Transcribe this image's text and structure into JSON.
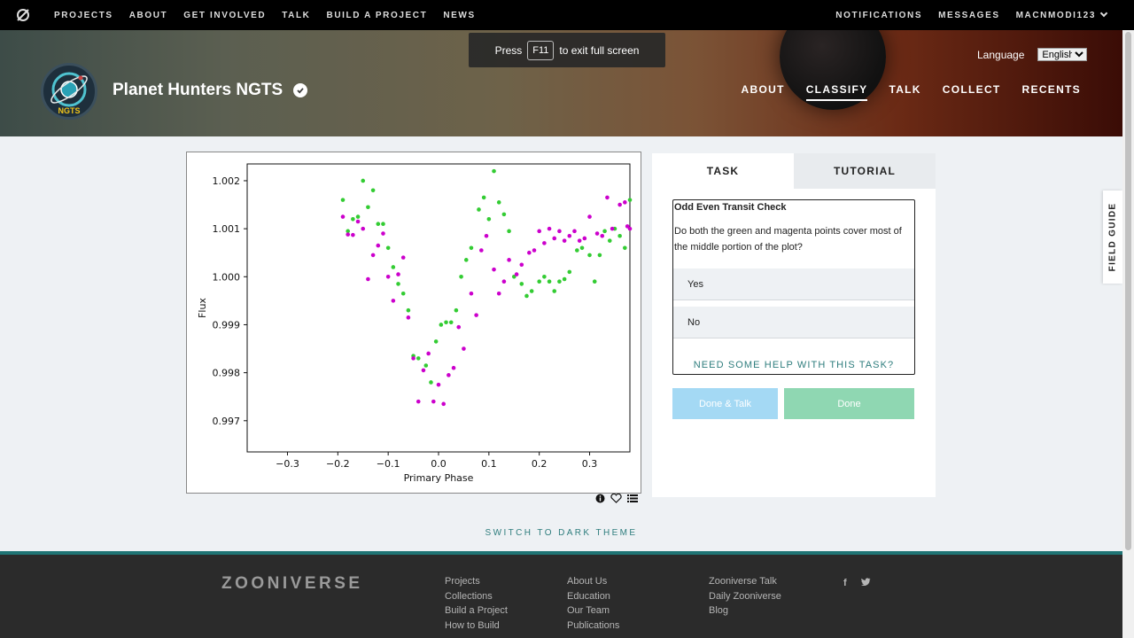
{
  "topnav": {
    "links": [
      "PROJECTS",
      "ABOUT",
      "GET INVOLVED",
      "TALK",
      "BUILD A PROJECT",
      "NEWS"
    ],
    "notifications": "NOTIFICATIONS",
    "messages": "MESSAGES",
    "username": "MACNMODI123"
  },
  "fullscreen_toast": {
    "press": "Press",
    "key": "F11",
    "rest": "to exit full screen"
  },
  "hero": {
    "project_title": "Planet Hunters NGTS",
    "badge_text": "NGTS",
    "language_label": "Language",
    "language_value": "English",
    "nav": [
      "ABOUT",
      "CLASSIFY",
      "TALK",
      "COLLECT",
      "RECENTS"
    ],
    "active_nav": "CLASSIFY"
  },
  "chart_data": {
    "type": "scatter",
    "xlabel": "Primary Phase",
    "ylabel": "Flux",
    "xlim": [
      -0.38,
      0.38
    ],
    "ylim": [
      0.99635,
      1.00235
    ],
    "xticks": [
      "−0.3",
      "−0.2",
      "−0.1",
      "0.0",
      "0.1",
      "0.2",
      "0.3"
    ],
    "yticks": [
      "1.002",
      "1.001",
      "1.000",
      "0.999",
      "0.998",
      "0.997"
    ],
    "series": [
      {
        "color": "#33cc33",
        "points": [
          [
            -0.19,
            1.0016
          ],
          [
            -0.18,
            1.00095
          ],
          [
            -0.17,
            1.0012
          ],
          [
            -0.16,
            1.00125
          ],
          [
            -0.15,
            1.002
          ],
          [
            -0.14,
            1.00145
          ],
          [
            -0.13,
            1.0018
          ],
          [
            -0.12,
            1.0011
          ],
          [
            -0.11,
            1.0011
          ],
          [
            -0.1,
            1.0006
          ],
          [
            -0.09,
            1.0002
          ],
          [
            -0.08,
            0.99985
          ],
          [
            -0.07,
            0.99965
          ],
          [
            -0.06,
            0.9993
          ],
          [
            -0.05,
            0.99835
          ],
          [
            -0.04,
            0.9983
          ],
          [
            -0.025,
            0.99815
          ],
          [
            -0.015,
            0.9978
          ],
          [
            -0.005,
            0.99865
          ],
          [
            0.005,
            0.999
          ],
          [
            0.015,
            0.99905
          ],
          [
            0.025,
            0.99905
          ],
          [
            0.035,
            0.9993
          ],
          [
            0.045,
            1.0
          ],
          [
            0.055,
            1.00035
          ],
          [
            0.065,
            1.0006
          ],
          [
            0.08,
            1.0014
          ],
          [
            0.09,
            1.00165
          ],
          [
            0.1,
            1.0012
          ],
          [
            0.11,
            1.0022
          ],
          [
            0.12,
            1.00155
          ],
          [
            0.13,
            1.0013
          ],
          [
            0.14,
            1.00095
          ],
          [
            0.15,
            1.0
          ],
          [
            0.165,
            0.99985
          ],
          [
            0.175,
            0.9996
          ],
          [
            0.185,
            0.9997
          ],
          [
            0.2,
            0.9999
          ],
          [
            0.21,
            1.0
          ],
          [
            0.22,
            0.9999
          ],
          [
            0.23,
            0.9997
          ],
          [
            0.24,
            0.9999
          ],
          [
            0.25,
            0.99995
          ],
          [
            0.26,
            1.0001
          ],
          [
            0.275,
            1.00055
          ],
          [
            0.285,
            1.0006
          ],
          [
            0.3,
            1.00045
          ],
          [
            0.31,
            0.9999
          ],
          [
            0.32,
            1.00045
          ],
          [
            0.33,
            1.00095
          ],
          [
            0.34,
            1.00075
          ],
          [
            0.35,
            1.001
          ],
          [
            0.36,
            1.00085
          ],
          [
            0.37,
            1.0006
          ],
          [
            0.38,
            1.0016
          ]
        ]
      },
      {
        "color": "#cc00cc",
        "points": [
          [
            -0.19,
            1.00125
          ],
          [
            -0.18,
            1.00088
          ],
          [
            -0.17,
            1.00087
          ],
          [
            -0.16,
            1.00115
          ],
          [
            -0.15,
            1.001
          ],
          [
            -0.14,
            0.99995
          ],
          [
            -0.13,
            1.00045
          ],
          [
            -0.12,
            1.00065
          ],
          [
            -0.11,
            1.0009
          ],
          [
            -0.1,
            1.0
          ],
          [
            -0.09,
            0.9995
          ],
          [
            -0.08,
            1.00005
          ],
          [
            -0.07,
            1.0004
          ],
          [
            -0.06,
            0.99915
          ],
          [
            -0.05,
            0.9983
          ],
          [
            -0.04,
            0.9974
          ],
          [
            -0.03,
            0.99805
          ],
          [
            -0.02,
            0.9984
          ],
          [
            -0.01,
            0.9974
          ],
          [
            0.0,
            0.99775
          ],
          [
            0.01,
            0.99735
          ],
          [
            0.02,
            0.99795
          ],
          [
            0.03,
            0.9981
          ],
          [
            0.04,
            0.99895
          ],
          [
            0.05,
            0.9985
          ],
          [
            0.065,
            0.99965
          ],
          [
            0.075,
            0.9992
          ],
          [
            0.085,
            1.00055
          ],
          [
            0.095,
            1.00085
          ],
          [
            0.11,
            1.00015
          ],
          [
            0.12,
            0.99965
          ],
          [
            0.13,
            0.9999
          ],
          [
            0.14,
            1.00035
          ],
          [
            0.155,
            1.00005
          ],
          [
            0.165,
            1.00025
          ],
          [
            0.18,
            1.0005
          ],
          [
            0.19,
            1.00055
          ],
          [
            0.2,
            1.00095
          ],
          [
            0.21,
            1.0007
          ],
          [
            0.22,
            1.001
          ],
          [
            0.23,
            1.0008
          ],
          [
            0.24,
            1.00095
          ],
          [
            0.25,
            1.00075
          ],
          [
            0.26,
            1.00085
          ],
          [
            0.27,
            1.00095
          ],
          [
            0.28,
            1.00075
          ],
          [
            0.29,
            1.0008
          ],
          [
            0.3,
            1.00125
          ],
          [
            0.315,
            1.0009
          ],
          [
            0.325,
            1.00085
          ],
          [
            0.335,
            1.00165
          ],
          [
            0.345,
            1.001
          ],
          [
            0.36,
            1.0015
          ],
          [
            0.37,
            1.00155
          ],
          [
            0.375,
            1.00105
          ],
          [
            0.38,
            1.001
          ]
        ]
      }
    ]
  },
  "subject_tools": {
    "info_icon": "info-icon",
    "favorite_icon": "heart-icon",
    "collect_icon": "list-icon"
  },
  "tabs": [
    "TASK",
    "TUTORIAL"
  ],
  "task": {
    "title": "Odd Even Transit Check",
    "question": "Do both the green and magenta points cover most of the middle portion of the plot?",
    "answers": [
      "Yes",
      "No"
    ],
    "help": "NEED SOME HELP WITH THIS TASK?",
    "done_talk": "Done & Talk",
    "done": "Done"
  },
  "field_guide": "FIELD GUIDE",
  "theme_switch": "SWITCH TO DARK THEME",
  "footer": {
    "brand": "ZOONIVERSE",
    "col1": [
      "Projects",
      "Collections",
      "Build a Project",
      "How to Build"
    ],
    "col2": [
      "About Us",
      "Education",
      "Our Team",
      "Publications"
    ],
    "col3": [
      "Zooniverse Talk",
      "Daily Zooniverse",
      "Blog"
    ],
    "social": [
      "f",
      "twitter-icon"
    ]
  },
  "colors": {
    "accent": "#2e7d7d",
    "done_talk": "#a4d9f4",
    "done": "#8fd7b2",
    "footer_bg": "#2b2b2b"
  }
}
